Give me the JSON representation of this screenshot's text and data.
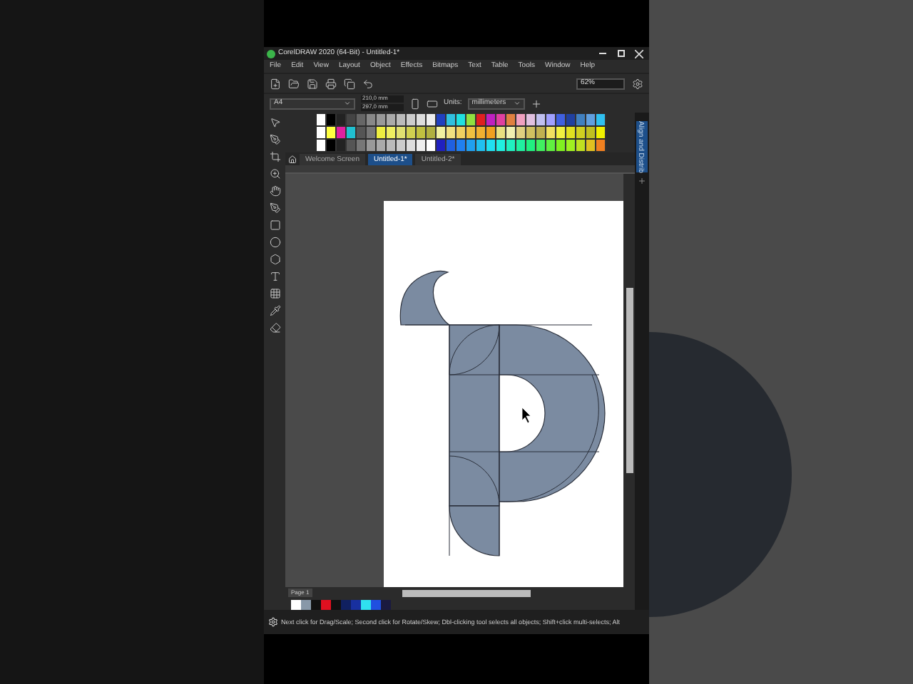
{
  "window": {
    "title": "CorelDRAW 2020 (64-Bit) - Untitled-1*"
  },
  "menu": [
    "File",
    "Edit",
    "View",
    "Layout",
    "Object",
    "Effects",
    "Bitmaps",
    "Text",
    "Table",
    "Tools",
    "Window",
    "Help"
  ],
  "toolbar": {
    "zoom": "62%"
  },
  "property_bar": {
    "page_size": "A4",
    "width": "210,0 mm",
    "height": "297,0 mm",
    "units_label": "Units:",
    "units": "millimeters"
  },
  "tabs": [
    {
      "label": "Welcome Screen",
      "selected": false
    },
    {
      "label": "Untitled-1*",
      "selected": true
    },
    {
      "label": "Untitled-2*",
      "selected": false
    }
  ],
  "docker": {
    "title": "Align and Distrib"
  },
  "page_tab": "Page 1",
  "status_bar": "Next click for Drag/Scale; Second click for Rotate/Skew; Dbl-clicking tool selects all objects; Shift+click multi-selects; Alt"
}
